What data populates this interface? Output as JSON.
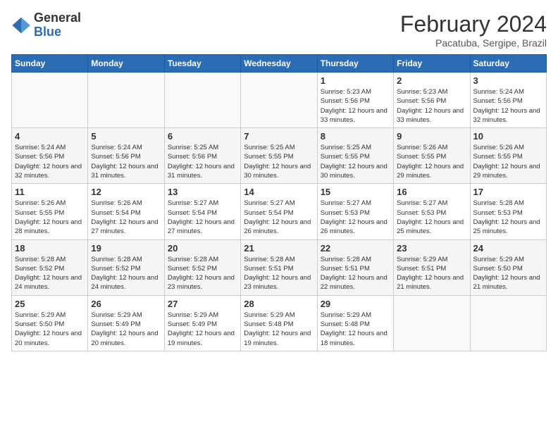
{
  "logo": {
    "general": "General",
    "blue": "Blue"
  },
  "title": "February 2024",
  "location": "Pacatuba, Sergipe, Brazil",
  "days_of_week": [
    "Sunday",
    "Monday",
    "Tuesday",
    "Wednesday",
    "Thursday",
    "Friday",
    "Saturday"
  ],
  "weeks": [
    [
      {
        "day": "",
        "info": ""
      },
      {
        "day": "",
        "info": ""
      },
      {
        "day": "",
        "info": ""
      },
      {
        "day": "",
        "info": ""
      },
      {
        "day": "1",
        "info": "Sunrise: 5:23 AM\nSunset: 5:56 PM\nDaylight: 12 hours\nand 33 minutes."
      },
      {
        "day": "2",
        "info": "Sunrise: 5:23 AM\nSunset: 5:56 PM\nDaylight: 12 hours\nand 33 minutes."
      },
      {
        "day": "3",
        "info": "Sunrise: 5:24 AM\nSunset: 5:56 PM\nDaylight: 12 hours\nand 32 minutes."
      }
    ],
    [
      {
        "day": "4",
        "info": "Sunrise: 5:24 AM\nSunset: 5:56 PM\nDaylight: 12 hours\nand 32 minutes."
      },
      {
        "day": "5",
        "info": "Sunrise: 5:24 AM\nSunset: 5:56 PM\nDaylight: 12 hours\nand 31 minutes."
      },
      {
        "day": "6",
        "info": "Sunrise: 5:25 AM\nSunset: 5:56 PM\nDaylight: 12 hours\nand 31 minutes."
      },
      {
        "day": "7",
        "info": "Sunrise: 5:25 AM\nSunset: 5:55 PM\nDaylight: 12 hours\nand 30 minutes."
      },
      {
        "day": "8",
        "info": "Sunrise: 5:25 AM\nSunset: 5:55 PM\nDaylight: 12 hours\nand 30 minutes."
      },
      {
        "day": "9",
        "info": "Sunrise: 5:26 AM\nSunset: 5:55 PM\nDaylight: 12 hours\nand 29 minutes."
      },
      {
        "day": "10",
        "info": "Sunrise: 5:26 AM\nSunset: 5:55 PM\nDaylight: 12 hours\nand 29 minutes."
      }
    ],
    [
      {
        "day": "11",
        "info": "Sunrise: 5:26 AM\nSunset: 5:55 PM\nDaylight: 12 hours\nand 28 minutes."
      },
      {
        "day": "12",
        "info": "Sunrise: 5:26 AM\nSunset: 5:54 PM\nDaylight: 12 hours\nand 27 minutes."
      },
      {
        "day": "13",
        "info": "Sunrise: 5:27 AM\nSunset: 5:54 PM\nDaylight: 12 hours\nand 27 minutes."
      },
      {
        "day": "14",
        "info": "Sunrise: 5:27 AM\nSunset: 5:54 PM\nDaylight: 12 hours\nand 26 minutes."
      },
      {
        "day": "15",
        "info": "Sunrise: 5:27 AM\nSunset: 5:53 PM\nDaylight: 12 hours\nand 26 minutes."
      },
      {
        "day": "16",
        "info": "Sunrise: 5:27 AM\nSunset: 5:53 PM\nDaylight: 12 hours\nand 25 minutes."
      },
      {
        "day": "17",
        "info": "Sunrise: 5:28 AM\nSunset: 5:53 PM\nDaylight: 12 hours\nand 25 minutes."
      }
    ],
    [
      {
        "day": "18",
        "info": "Sunrise: 5:28 AM\nSunset: 5:52 PM\nDaylight: 12 hours\nand 24 minutes."
      },
      {
        "day": "19",
        "info": "Sunrise: 5:28 AM\nSunset: 5:52 PM\nDaylight: 12 hours\nand 24 minutes."
      },
      {
        "day": "20",
        "info": "Sunrise: 5:28 AM\nSunset: 5:52 PM\nDaylight: 12 hours\nand 23 minutes."
      },
      {
        "day": "21",
        "info": "Sunrise: 5:28 AM\nSunset: 5:51 PM\nDaylight: 12 hours\nand 23 minutes."
      },
      {
        "day": "22",
        "info": "Sunrise: 5:28 AM\nSunset: 5:51 PM\nDaylight: 12 hours\nand 22 minutes."
      },
      {
        "day": "23",
        "info": "Sunrise: 5:29 AM\nSunset: 5:51 PM\nDaylight: 12 hours\nand 21 minutes."
      },
      {
        "day": "24",
        "info": "Sunrise: 5:29 AM\nSunset: 5:50 PM\nDaylight: 12 hours\nand 21 minutes."
      }
    ],
    [
      {
        "day": "25",
        "info": "Sunrise: 5:29 AM\nSunset: 5:50 PM\nDaylight: 12 hours\nand 20 minutes."
      },
      {
        "day": "26",
        "info": "Sunrise: 5:29 AM\nSunset: 5:49 PM\nDaylight: 12 hours\nand 20 minutes."
      },
      {
        "day": "27",
        "info": "Sunrise: 5:29 AM\nSunset: 5:49 PM\nDaylight: 12 hours\nand 19 minutes."
      },
      {
        "day": "28",
        "info": "Sunrise: 5:29 AM\nSunset: 5:48 PM\nDaylight: 12 hours\nand 19 minutes."
      },
      {
        "day": "29",
        "info": "Sunrise: 5:29 AM\nSunset: 5:48 PM\nDaylight: 12 hours\nand 18 minutes."
      },
      {
        "day": "",
        "info": ""
      },
      {
        "day": "",
        "info": ""
      }
    ]
  ]
}
